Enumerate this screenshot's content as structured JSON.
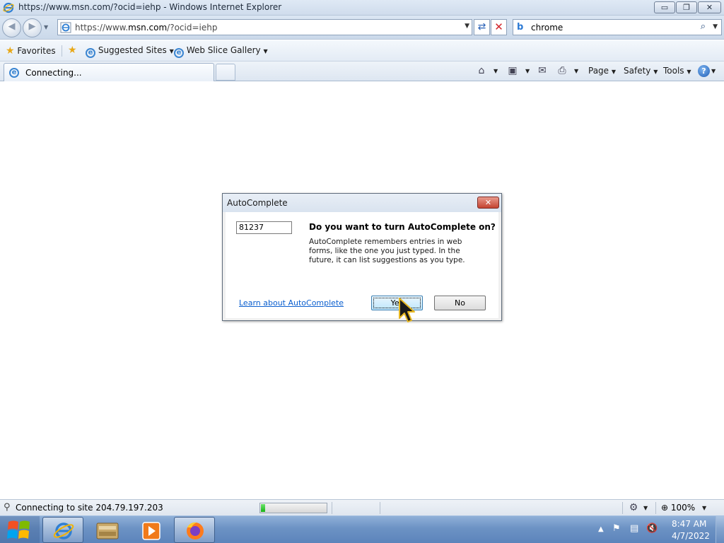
{
  "window": {
    "title": "https://www.msn.com/?ocid=iehp - Windows Internet Explorer",
    "min_label": "▭",
    "max_label": "❐",
    "close_label": "✕"
  },
  "navbar": {
    "url_prefix": "https://www.",
    "url_domain": "msn.com",
    "url_suffix": "/?ocid=iehp",
    "search_text": "chrome"
  },
  "favorites": {
    "favorites_label": "Favorites",
    "suggested_sites_label": "Suggested Sites",
    "web_slice_gallery_label": "Web Slice Gallery"
  },
  "tab": {
    "label": "Connecting..."
  },
  "commandbar": {
    "page_label": "Page",
    "safety_label": "Safety",
    "tools_label": "Tools"
  },
  "dialog": {
    "title": "AutoComplete",
    "field_value": "81237",
    "heading": "Do you want to turn AutoComplete on?",
    "description": "AutoComplete remembers entries in web forms, like the one you just typed. In the future, it can list suggestions as you type.",
    "learn_link": "Learn about AutoComplete",
    "yes_label": "Yes",
    "no_label": "No"
  },
  "status": {
    "text": "Connecting to site 204.79.197.203",
    "progress": 0.06,
    "zoom": "100%"
  },
  "taskbar": {
    "time": "8:47 AM",
    "date": "4/7/2022",
    "apps": [
      "internet-explorer",
      "file-manager",
      "media-player",
      "firefox"
    ]
  },
  "colors": {
    "link": "#0b5fcf",
    "progress_fill": "#16b416",
    "taskbar": "#6c92c4"
  }
}
